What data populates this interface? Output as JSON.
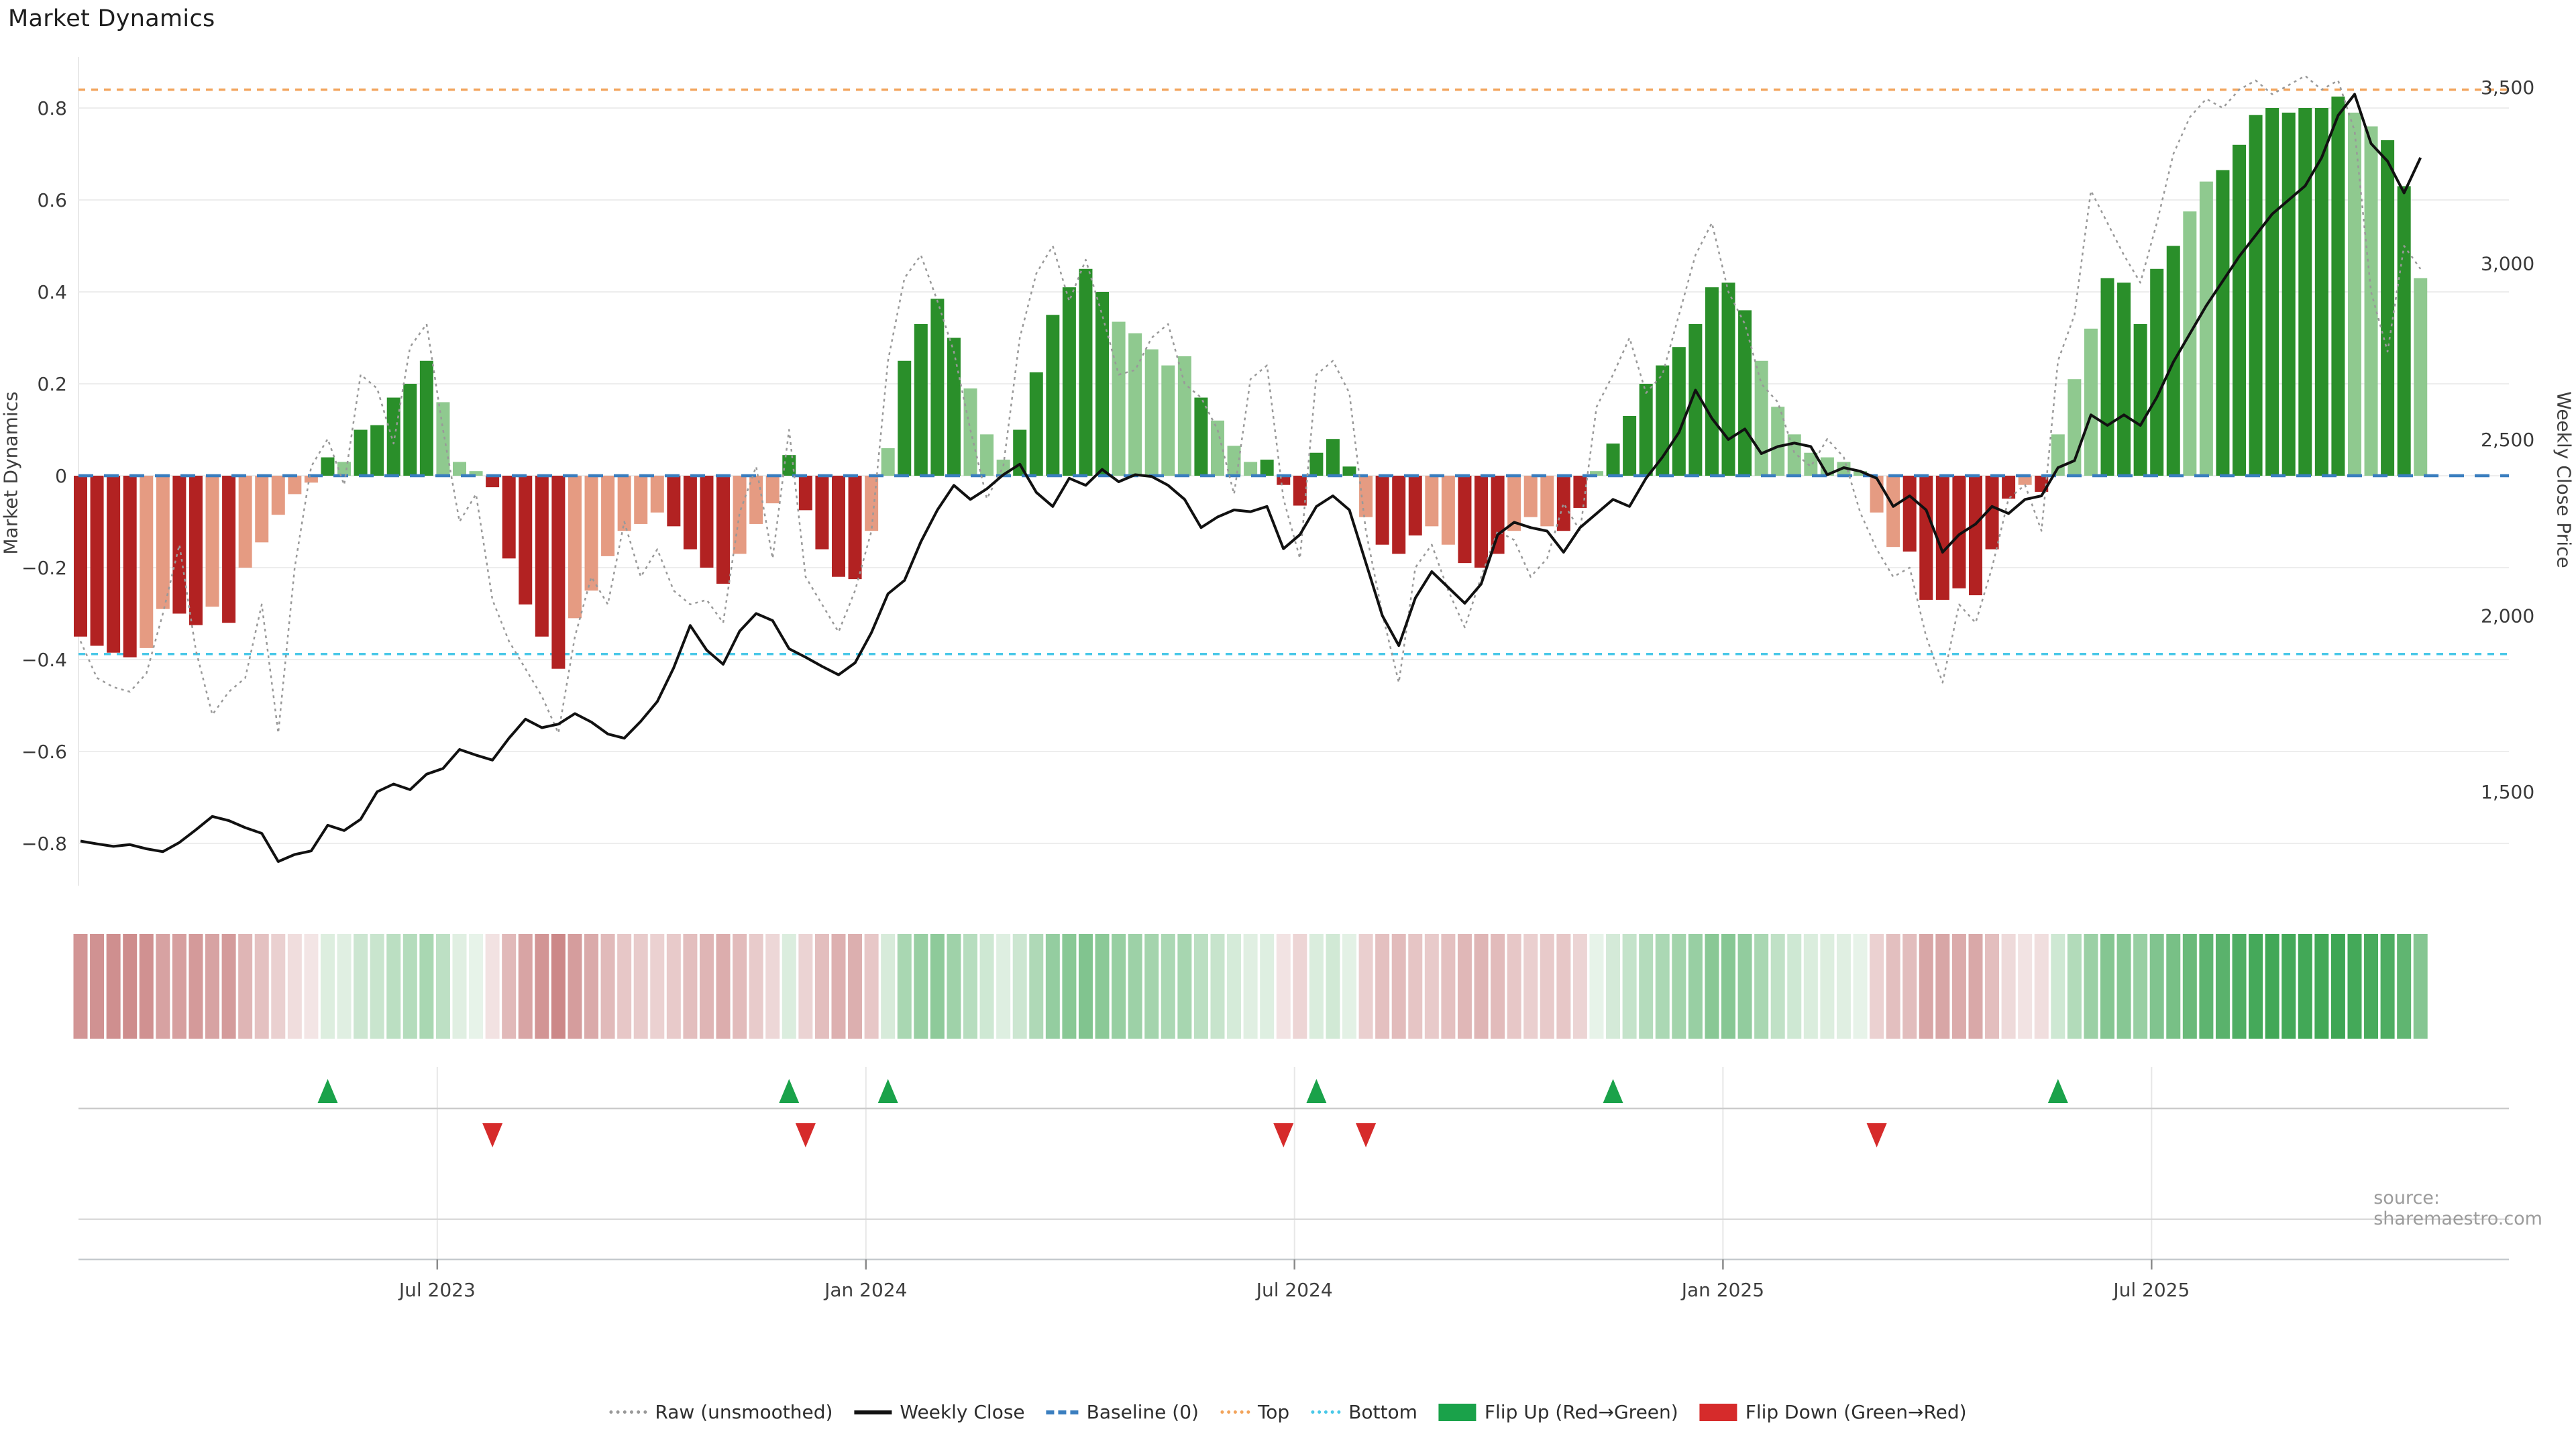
{
  "title": "Market Dynamics",
  "source": "source: sharemaestro.com",
  "left_axis": {
    "title": "Market Dynamics",
    "ticks": [
      {
        "v": 0.8,
        "label": "0.8"
      },
      {
        "v": 0.6,
        "label": "0.6"
      },
      {
        "v": 0.4,
        "label": "0.4"
      },
      {
        "v": 0.2,
        "label": "0.2"
      },
      {
        "v": 0.0,
        "label": "0"
      },
      {
        "v": -0.2,
        "label": "−0.2"
      },
      {
        "v": -0.4,
        "label": "−0.4"
      },
      {
        "v": -0.6,
        "label": "−0.6"
      },
      {
        "v": -0.8,
        "label": "−0.8"
      }
    ]
  },
  "right_axis": {
    "title": "Weekly Close Price",
    "ticks": [
      {
        "v": 3500,
        "label": "3,500"
      },
      {
        "v": 3000,
        "label": "3,000"
      },
      {
        "v": 2500,
        "label": "2,500"
      },
      {
        "v": 2000,
        "label": "2,000"
      },
      {
        "v": 1500,
        "label": "1,500"
      }
    ]
  },
  "x_axis": {
    "ticks": [
      {
        "week": 21.65,
        "label": "Jul 2023"
      },
      {
        "week": 47.66,
        "label": "Jan 2024"
      },
      {
        "week": 73.67,
        "label": "Jul 2024"
      },
      {
        "week": 99.67,
        "label": "Jan 2025"
      },
      {
        "week": 125.68,
        "label": "Jul 2025"
      }
    ]
  },
  "legend": {
    "items": [
      {
        "name": "raw",
        "label": "Raw (unsmoothed)",
        "swatch": "dot-gray"
      },
      {
        "name": "weekly-close",
        "label": "Weekly Close",
        "swatch": "line-black"
      },
      {
        "name": "baseline",
        "label": "Baseline (0)",
        "swatch": "dash-blue"
      },
      {
        "name": "top",
        "label": "Top",
        "swatch": "dot-orange"
      },
      {
        "name": "bottom",
        "label": "Bottom",
        "swatch": "dot-cyan"
      },
      {
        "name": "flip-up",
        "label": "Flip Up (Red→Green)",
        "swatch": "tri-up"
      },
      {
        "name": "flip-down",
        "label": "Flip Down (Green→Red)",
        "swatch": "tri-down"
      }
    ]
  },
  "colors": {
    "bar_dark_red": "#b22222",
    "bar_light_red": "#e59b82",
    "bar_dark_green": "#2a8f2a",
    "bar_light_green": "#8fc98f",
    "baseline_blue": "#3a7ebf",
    "top_orange": "#f2a45c",
    "bottom_cyan": "#49c8e8",
    "raw_gray": "#999999",
    "price_black": "#111111",
    "grid": "#ededed",
    "spine": "#e9e9e9",
    "month_grid": "#e7e7e7",
    "row_line": "#cccccc",
    "flip_up_green": "#1aa24a",
    "flip_down_red": "#d62b2b",
    "tick_text": "#3a3a3a"
  },
  "chart_data": {
    "type": "bar",
    "subtype": "oscillator-with-price-overlay",
    "frequency": "weekly",
    "weeks": 143,
    "ylim_left": [
      -0.9,
      0.93
    ],
    "ylim_right": [
      1290,
      3560
    ],
    "baseline": 0,
    "top_line": 0.84,
    "bottom_line": -0.388,
    "grid": "horizontal-only",
    "legend_position": "bottom-center",
    "oscillator": [
      -0.35,
      -0.37,
      -0.385,
      -0.395,
      -0.375,
      -0.29,
      -0.3,
      -0.325,
      -0.285,
      -0.32,
      -0.2,
      -0.145,
      -0.085,
      -0.04,
      -0.015,
      0.04,
      0.03,
      0.1,
      0.11,
      0.17,
      0.2,
      0.25,
      0.16,
      0.03,
      0.01,
      -0.025,
      -0.18,
      -0.28,
      -0.35,
      -0.42,
      -0.31,
      -0.25,
      -0.175,
      -0.12,
      -0.105,
      -0.08,
      -0.11,
      -0.16,
      -0.2,
      -0.235,
      -0.17,
      -0.105,
      -0.06,
      0.045,
      -0.075,
      -0.16,
      -0.22,
      -0.225,
      -0.12,
      0.06,
      0.25,
      0.33,
      0.385,
      0.3,
      0.19,
      0.09,
      0.035,
      0.1,
      0.225,
      0.35,
      0.41,
      0.45,
      0.4,
      0.335,
      0.31,
      0.275,
      0.24,
      0.26,
      0.17,
      0.12,
      0.065,
      0.03,
      0.035,
      -0.02,
      -0.065,
      0.05,
      0.08,
      0.02,
      -0.09,
      -0.15,
      -0.17,
      -0.13,
      -0.11,
      -0.15,
      -0.19,
      -0.2,
      -0.17,
      -0.12,
      -0.09,
      -0.11,
      -0.12,
      -0.07,
      0.01,
      0.07,
      0.13,
      0.2,
      0.24,
      0.28,
      0.33,
      0.41,
      0.42,
      0.36,
      0.25,
      0.15,
      0.09,
      0.05,
      0.04,
      0.03,
      0.01,
      -0.08,
      -0.155,
      -0.165,
      -0.27,
      -0.27,
      -0.245,
      -0.26,
      -0.16,
      -0.05,
      -0.02,
      -0.035,
      0.09,
      0.21,
      0.32,
      0.43,
      0.42,
      0.33,
      0.45,
      0.5,
      0.575,
      0.64,
      0.665,
      0.72,
      0.785,
      0.8,
      0.79,
      0.8,
      0.8,
      0.825,
      0.79,
      0.76,
      0.73,
      0.63,
      0.43
    ],
    "shade": "ddddllddldllllldldddddllldddddllllllddddllldddddllddddlllddddddllllldlllddddddldddlldddlllddldddddddddlllllllllksdddddldllldddddllddddddddllddlllll",
    "raw": [
      -0.36,
      -0.44,
      -0.46,
      -0.47,
      -0.43,
      -0.3,
      -0.15,
      -0.38,
      -0.52,
      -0.47,
      -0.44,
      -0.28,
      -0.56,
      -0.2,
      0.02,
      0.08,
      -0.02,
      0.22,
      0.19,
      0.07,
      0.28,
      0.33,
      0.1,
      -0.1,
      -0.04,
      -0.27,
      -0.36,
      -0.42,
      -0.48,
      -0.56,
      -0.35,
      -0.22,
      -0.28,
      -0.1,
      -0.22,
      -0.16,
      -0.25,
      -0.28,
      -0.27,
      -0.32,
      -0.08,
      0.02,
      -0.18,
      0.1,
      -0.22,
      -0.28,
      -0.34,
      -0.25,
      -0.12,
      0.25,
      0.43,
      0.48,
      0.38,
      0.27,
      0.1,
      -0.05,
      0.02,
      0.3,
      0.44,
      0.5,
      0.38,
      0.47,
      0.35,
      0.22,
      0.23,
      0.3,
      0.33,
      0.2,
      0.17,
      0.1,
      -0.04,
      0.21,
      0.24,
      -0.05,
      -0.18,
      0.22,
      0.25,
      0.18,
      -0.12,
      -0.3,
      -0.45,
      -0.2,
      -0.15,
      -0.25,
      -0.33,
      -0.22,
      -0.12,
      -0.14,
      -0.22,
      -0.18,
      -0.06,
      -0.12,
      0.15,
      0.22,
      0.3,
      0.18,
      0.22,
      0.35,
      0.48,
      0.55,
      0.4,
      0.33,
      0.2,
      0.16,
      0.05,
      0.02,
      0.08,
      0.04,
      -0.08,
      -0.16,
      -0.22,
      -0.2,
      -0.35,
      -0.45,
      -0.28,
      -0.32,
      -0.2,
      -0.05,
      -0.02,
      -0.12,
      0.25,
      0.35,
      0.62,
      0.55,
      0.48,
      0.42,
      0.55,
      0.7,
      0.78,
      0.82,
      0.8,
      0.84,
      0.86,
      0.83,
      0.85,
      0.87,
      0.84,
      0.86,
      0.75,
      0.4,
      0.27,
      0.5,
      0.45
    ],
    "price": [
      1360,
      1352,
      1345,
      1350,
      1338,
      1330,
      1356,
      1392,
      1430,
      1418,
      1398,
      1382,
      1302,
      1322,
      1332,
      1405,
      1390,
      1422,
      1500,
      1522,
      1506,
      1550,
      1566,
      1620,
      1604,
      1590,
      1652,
      1706,
      1682,
      1692,
      1722,
      1698,
      1664,
      1652,
      1700,
      1756,
      1852,
      1972,
      1902,
      1862,
      1956,
      2006,
      1986,
      1906,
      1882,
      1856,
      1832,
      1866,
      1952,
      2062,
      2100,
      2210,
      2300,
      2370,
      2330,
      2360,
      2400,
      2430,
      2350,
      2310,
      2390,
      2370,
      2415,
      2380,
      2400,
      2395,
      2370,
      2330,
      2250,
      2280,
      2300,
      2295,
      2310,
      2190,
      2230,
      2310,
      2340,
      2300,
      2150,
      2000,
      1915,
      2050,
      2125,
      2080,
      2035,
      2090,
      2230,
      2265,
      2250,
      2240,
      2180,
      2250,
      2290,
      2330,
      2310,
      2390,
      2450,
      2520,
      2640,
      2560,
      2500,
      2530,
      2460,
      2480,
      2490,
      2480,
      2400,
      2420,
      2410,
      2390,
      2310,
      2340,
      2300,
      2180,
      2230,
      2260,
      2310,
      2290,
      2330,
      2340,
      2420,
      2440,
      2570,
      2540,
      2570,
      2540,
      2620,
      2720,
      2800,
      2880,
      2950,
      3020,
      3080,
      3140,
      3180,
      3220,
      3300,
      3420,
      3480,
      3340,
      3290,
      3200,
      3300
    ],
    "flip_up_weeks": [
      15,
      43,
      49,
      75,
      93,
      120
    ],
    "flip_down_weeks": [
      25,
      44,
      73,
      78,
      109
    ]
  }
}
